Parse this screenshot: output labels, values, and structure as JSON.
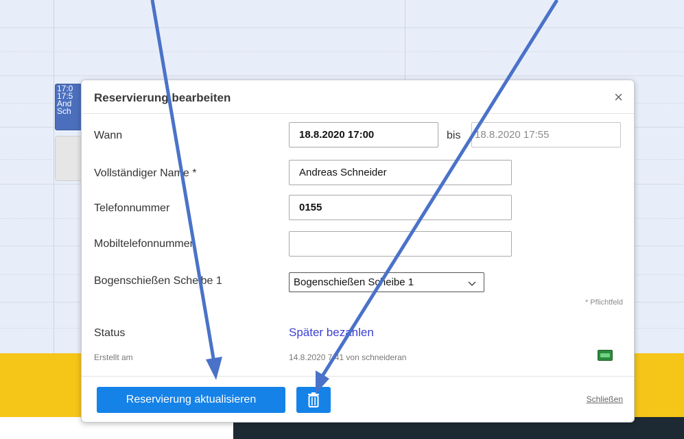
{
  "calendar": {
    "event": {
      "time_start": "17:0",
      "time_end": "17:5",
      "name_a": "And",
      "name_b": "Sch"
    }
  },
  "dialog": {
    "title": "Reservierung bearbeiten",
    "close_symbol": "×",
    "fields": {
      "wann_label": "Wann",
      "wann_from": "18.8.2020  17:00",
      "bis_label": "bis",
      "wann_to": "18.8.2020  17:55",
      "name_label": "Vollständiger Name *",
      "name_value": "Andreas Schneider",
      "phone_label": "Telefonnummer",
      "phone_value": "0155",
      "mobile_label": "Mobiltelefonnummer",
      "mobile_value": "",
      "resource_label": "Bogenschießen Scheibe 1",
      "resource_value": "Bogenschießen Scheibe 1"
    },
    "required_note": "* Pflichtfeld",
    "status_label": "Status",
    "status_value": "Später bezahlen",
    "created_label": "Erstellt am",
    "created_value": "14.8.2020 7:41 von schneideran",
    "buttons": {
      "update": "Reservierung aktualisieren",
      "delete_icon": "trash-icon",
      "close": "Schließen"
    }
  },
  "colors": {
    "primary": "#1582e8",
    "status_link": "#3b3fd1",
    "arrow": "#4a72c8",
    "band": "#f5c518"
  }
}
